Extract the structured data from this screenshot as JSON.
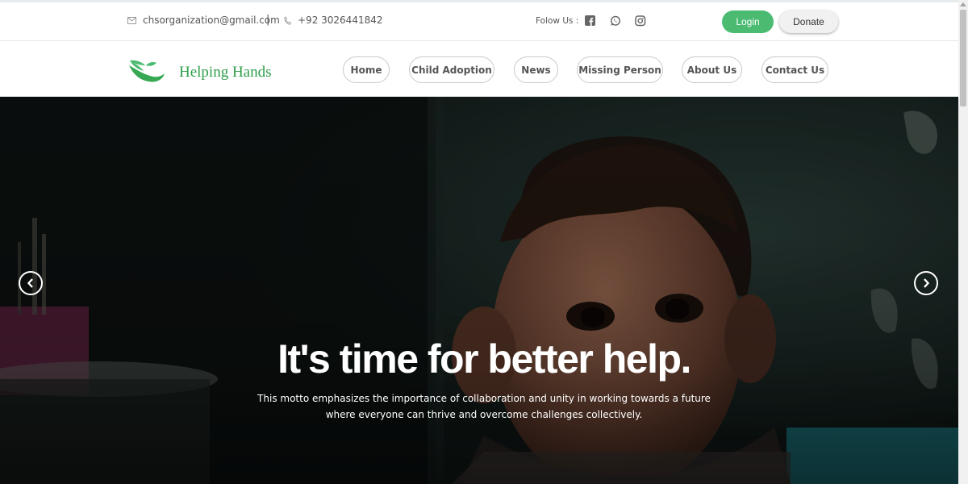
{
  "topbar": {
    "email": "chsorganization@gmail.com",
    "separator": "|",
    "phone": "+92 3026441842",
    "follow_label": "Folow Us :",
    "social_icons": [
      "facebook-icon",
      "whatsapp-icon",
      "instagram-icon"
    ],
    "login_label": "Login",
    "donate_label": "Donate"
  },
  "brand": {
    "name": "Helping Hands",
    "color": "#2e9e4a"
  },
  "nav": {
    "items": [
      {
        "label": "Home"
      },
      {
        "label": "Child Adoption"
      },
      {
        "label": "News"
      },
      {
        "label": "Missing Person"
      },
      {
        "label": "About Us"
      },
      {
        "label": "Contact Us"
      }
    ]
  },
  "hero": {
    "headline": "It's time for better help.",
    "subtext": "This motto emphasizes the importance of collaboration and unity in working towards a future where everyone can thrive and overcome challenges collectively."
  },
  "colors": {
    "accent_green": "#4cbb72",
    "donate_bg": "#f1f1f1"
  }
}
